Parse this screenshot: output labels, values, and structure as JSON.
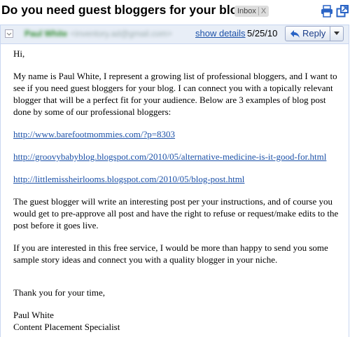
{
  "subject": "Do you need guest bloggers for your blog ?",
  "label": {
    "name": "Inbox",
    "remove": "X"
  },
  "icons": {
    "print": "printer-icon",
    "new_window": "new-window-icon",
    "collapse": "collapse-icon",
    "reply": "reply-arrow-icon",
    "dropdown": "chevron-down-icon"
  },
  "header": {
    "sender_name": "Paul White",
    "sender_email": "<inventory.ad@gmail.com>",
    "show_details": "show details",
    "date": "5/25/10",
    "reply": "Reply"
  },
  "body": {
    "greeting": "Hi,",
    "intro": "My name is Paul White, I represent a growing list of professional bloggers, and I want to see if you need guest bloggers for your blog. I can connect you with a topically relevant blogger that will be a perfect fit for your audience. Below are 3 examples of blog post done by some of our professional bloggers:",
    "links": [
      "http://www.barefootmommies.com/?p=8303",
      "http://groovybabyblog.blogspot.com/2010/05/alternative-medicine-is-it-good-for.html",
      "http://littlemissheirlooms.blogspot.com/2010/05/blog-post.html"
    ],
    "para2": "The guest blogger will write an interesting post per your instructions, and of course you would get to pre-approve all post and have the right to refuse or request/make edits to the post before it goes live.",
    "para3": "If you are interested in this free service, I would be more than happy to send you some sample story ideas and connect you with a quality blogger in your niche.",
    "closing": "Thank you for your time,",
    "signature_name": "Paul White",
    "signature_title": "Content Placement Specialist"
  }
}
